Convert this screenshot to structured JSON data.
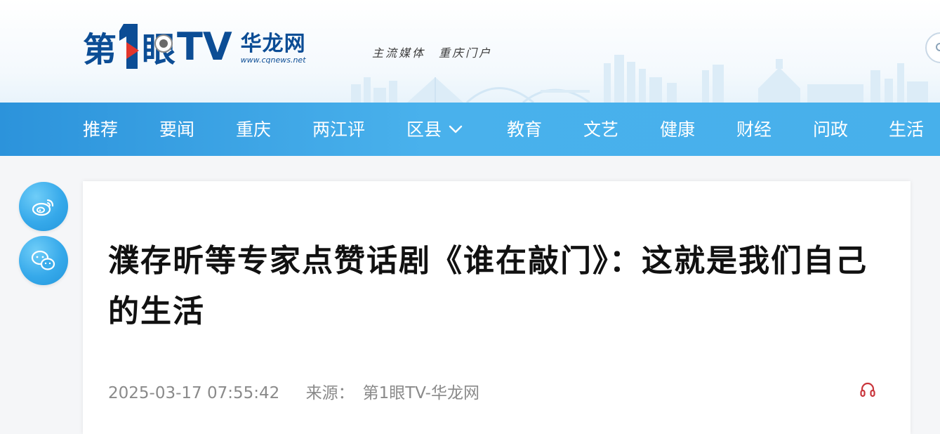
{
  "header": {
    "logo": {
      "brand_di": "第",
      "brand_eye": "眼",
      "brand_tv": "TV",
      "hualong": "华龙网",
      "url": "www.cqnews.net"
    },
    "slogan": "主流媒体　重庆门户"
  },
  "nav": {
    "items": [
      {
        "label": "推荐"
      },
      {
        "label": "要闻"
      },
      {
        "label": "重庆"
      },
      {
        "label": "两江评"
      },
      {
        "label": "区县"
      },
      {
        "label": "教育"
      },
      {
        "label": "文艺"
      },
      {
        "label": "健康"
      },
      {
        "label": "财经"
      },
      {
        "label": "问政"
      },
      {
        "label": "生活"
      }
    ]
  },
  "share": {
    "weibo_icon": "weibo-icon",
    "wechat_icon": "wechat-icon"
  },
  "article": {
    "title": "濮存昕等专家点赞话剧《谁在敲门》：这就是我们自己的生活",
    "datetime": "2025-03-17 07:55:42",
    "source_label": "来源：",
    "source": "第1眼TV-华龙网"
  },
  "colors": {
    "brand_blue": "#0c4d95",
    "nav_blue": "#3ba4e6",
    "audio_red": "#c9353b"
  }
}
